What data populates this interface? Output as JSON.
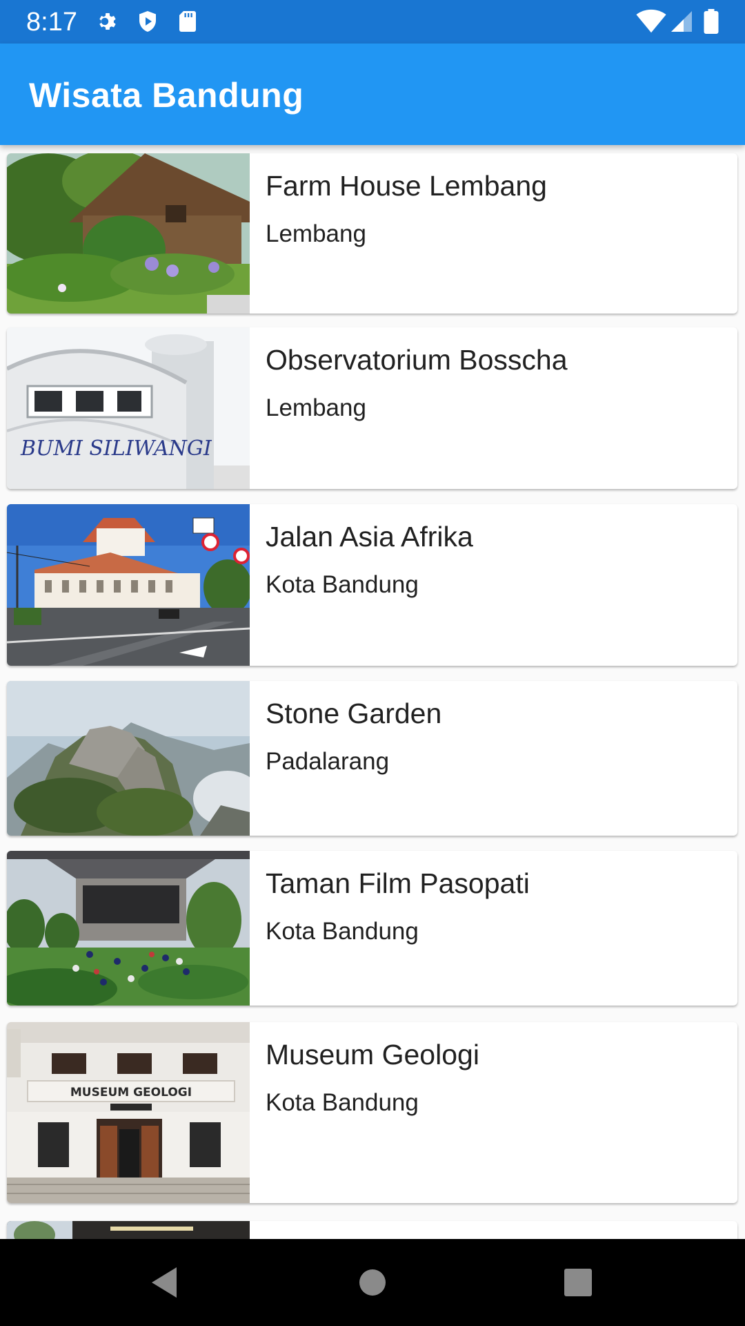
{
  "status_bar": {
    "time": "8:17",
    "icons": [
      "gear-icon",
      "shield-icon",
      "sd-card-icon",
      "wifi-icon",
      "cell-signal-icon",
      "battery-icon"
    ]
  },
  "app_bar": {
    "title": "Wisata Bandung",
    "color": "#2196f3"
  },
  "places": [
    {
      "name": "Farm House Lembang",
      "location": "Lembang",
      "image": "farm-house-photo"
    },
    {
      "name": "Observatorium Bosscha",
      "location": "Lembang",
      "image": "bumi-siliwangi-building-photo"
    },
    {
      "name": "Jalan Asia Afrika",
      "location": "Kota Bandung",
      "image": "street-building-photo"
    },
    {
      "name": "Stone Garden",
      "location": "Padalarang",
      "image": "rocky-hill-photo"
    },
    {
      "name": "Taman Film Pasopati",
      "location": "Kota Bandung",
      "image": "park-under-bridge-photo"
    },
    {
      "name": "Museum Geologi",
      "location": "Kota Bandung",
      "image": "museum-facade-photo",
      "image_text": "MUSEUM GEOLOGI"
    }
  ],
  "nav_bar": {
    "buttons": [
      "back-icon",
      "home-icon",
      "recents-icon"
    ]
  }
}
